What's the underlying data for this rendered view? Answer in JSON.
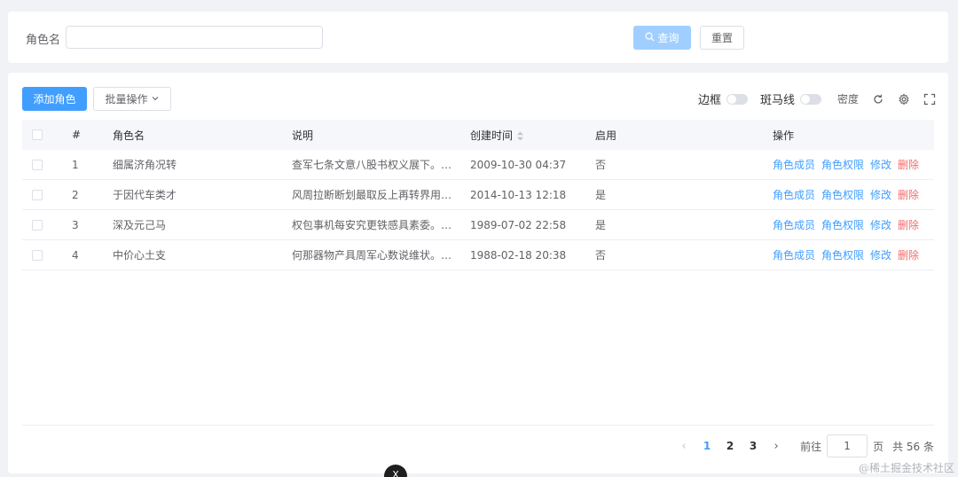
{
  "search": {
    "label": "角色名",
    "value": "",
    "placeholder": "",
    "query_label": "查询",
    "reset_label": "重置"
  },
  "toolbar": {
    "add_label": "添加角色",
    "batch_label": "批量操作",
    "border_label": "边框",
    "stripe_label": "斑马线",
    "density_label": "密度"
  },
  "table": {
    "columns": {
      "idx": "#",
      "name": "角色名",
      "desc": "说明",
      "time": "创建时间",
      "enable": "启用",
      "ops": "操作"
    },
    "rows": [
      {
        "idx": "1",
        "name": "细属济角况转",
        "desc": "查军七条文意八股书权义展下。…",
        "time": "2009-10-30 04:37",
        "enable": "否"
      },
      {
        "idx": "2",
        "name": "于因代车类才",
        "desc": "风周拉断断划最取反上再转界用…",
        "time": "2014-10-13 12:18",
        "enable": "是"
      },
      {
        "idx": "3",
        "name": "深及元己马",
        "desc": "权包事机每安究更铁感具素委。…",
        "time": "1989-07-02 22:58",
        "enable": "是"
      },
      {
        "idx": "4",
        "name": "中价心土支",
        "desc": "何那器物产具周军心数说维状。…",
        "time": "1988-02-18 20:38",
        "enable": "否"
      }
    ],
    "ops": {
      "members": "角色成员",
      "perms": "角色权限",
      "edit": "修改",
      "delete": "删除"
    }
  },
  "pagination": {
    "pages": [
      "1",
      "2",
      "3"
    ],
    "current": "1",
    "goto_label": "前往",
    "goto_value": "1",
    "page_label": "页",
    "total_label": "共 56 条"
  },
  "overlay": {
    "close_glyph": "X",
    "watermark": "@稀土掘金技术社区"
  },
  "colors": {
    "primary": "#409eff",
    "danger": "#f56c6c",
    "primary_light": "#a0cfff"
  }
}
